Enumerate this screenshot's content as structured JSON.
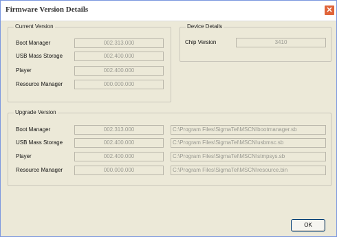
{
  "window": {
    "title": "Firmware Version Details",
    "close_glyph": "✕"
  },
  "current_version": {
    "legend": "Current Version",
    "rows": [
      {
        "label": "Boot Manager",
        "value": "002.313.000"
      },
      {
        "label": "USB Mass Storage",
        "value": "002.400.000"
      },
      {
        "label": "Player",
        "value": "002.400.000"
      },
      {
        "label": "Resource Manager",
        "value": "000.000.000"
      }
    ]
  },
  "device_details": {
    "legend": "Device Details",
    "chip_label": "Chip Version",
    "chip_value": "3410"
  },
  "upgrade_version": {
    "legend": "Upgrade Version",
    "rows": [
      {
        "label": "Boot Manager",
        "value": "002.313.000",
        "path": "C:\\Program Files\\SigmaTel\\MSCN\\bootmanager.sb"
      },
      {
        "label": "USB Mass Storage",
        "value": "002.400.000",
        "path": "C:\\Program Files\\SigmaTel\\MSCN\\usbmsc.sb"
      },
      {
        "label": "Player",
        "value": "002.400.000",
        "path": "C:\\Program Files\\SigmaTel\\MSCN\\stmpsys.sb"
      },
      {
        "label": "Resource Manager",
        "value": "000.000.000",
        "path": "C:\\Program Files\\SigmaTel\\MSCN\\resource.bin"
      }
    ]
  },
  "buttons": {
    "ok": "OK"
  }
}
